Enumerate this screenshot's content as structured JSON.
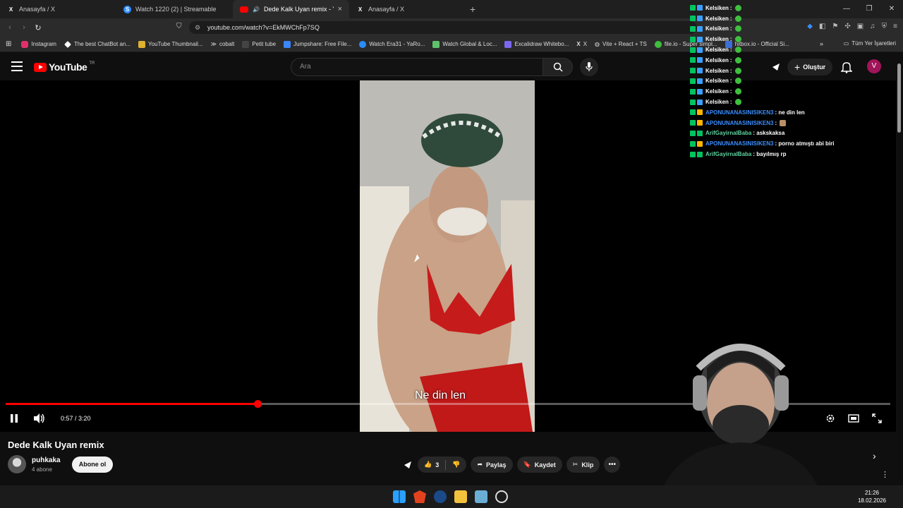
{
  "browser": {
    "tabs": [
      {
        "label": "Anasayfa / X",
        "icon": "x-logo",
        "active": false
      },
      {
        "label": "Watch 1220 (2) | Streamable",
        "icon": "streamable-logo",
        "active": false
      },
      {
        "label": "Dede Kalk Uyan remix - YouTube",
        "icon": "youtube-logo",
        "active": true
      },
      {
        "label": "Anasayfa / X",
        "icon": "x-logo",
        "active": false
      }
    ],
    "url": "youtube.com/watch?v=EkMWChFp7SQ",
    "bookmarks": [
      {
        "label": "Instagram",
        "color": "#e1306c"
      },
      {
        "label": "The best ChatBot an...",
        "color": "#ffffff"
      },
      {
        "label": "YouTube Thumbnail...",
        "color": "#e0b030"
      },
      {
        "label": "cobalt",
        "color": "#ffffff"
      },
      {
        "label": "Petit tube",
        "color": "#333333"
      },
      {
        "label": "Jumpshare: Free File...",
        "color": "#3a86ff"
      },
      {
        "label": "Watch Era31 - YaRo...",
        "color": "#2a8cff"
      },
      {
        "label": "Watch Global & Loc...",
        "color": "#5ec26a"
      },
      {
        "label": "Excalidraw Whitebo...",
        "color": "#7b68ee"
      },
      {
        "label": "X",
        "color": "#ffffff"
      },
      {
        "label": "Vite + React + TS",
        "color": "#cccccc"
      },
      {
        "label": "file.io - Super simpl...",
        "color": "#3fbf3f"
      },
      {
        "label": "hitbox.io - Official Si...",
        "color": "#3c6fd6"
      }
    ],
    "bookmarks_right": "Tüm Yer İşaretleri"
  },
  "youtube": {
    "logo_text": "YouTube",
    "region": "TR",
    "search_placeholder": "Ara",
    "create_label": "Oluştur",
    "avatar_letter": "V"
  },
  "player": {
    "caption": "Ne din len",
    "time": "0:57 / 3:20",
    "progress_fraction": 0.285
  },
  "video": {
    "title": "Dede Kalk Uyan remix",
    "channel": "puhkaka",
    "subscribers": "4 abone",
    "subscribe_label": "Abone ol",
    "likes": "3",
    "share_label": "Paylaş",
    "save_label": "Kaydet",
    "clip_label": "Klip"
  },
  "chat": [
    {
      "user": "Kelsiken",
      "message": ":",
      "emote": "pepe",
      "color": "#ffffff"
    },
    {
      "user": "Kelsiken",
      "message": ":",
      "emote": "pepe",
      "color": "#ffffff"
    },
    {
      "user": "Kelsiken",
      "message": ":",
      "emote": "pepe",
      "color": "#ffffff"
    },
    {
      "user": "Kelsiken",
      "message": ":",
      "emote": "pepe",
      "color": "#ffffff"
    },
    {
      "user": "Kelsiken",
      "message": ":",
      "emote": "pepe",
      "color": "#ffffff"
    },
    {
      "user": "Kelsiken",
      "message": ":",
      "emote": "pepe",
      "color": "#ffffff"
    },
    {
      "user": "Kelsiken",
      "message": ":",
      "emote": "pepe",
      "color": "#ffffff"
    },
    {
      "user": "Kelsiken",
      "message": ":",
      "emote": "pepe",
      "color": "#ffffff"
    },
    {
      "user": "Kelsiken",
      "message": ":",
      "emote": "pepe",
      "color": "#ffffff"
    },
    {
      "user": "Kelsiken",
      "message": ":",
      "emote": "pepe",
      "color": "#ffffff"
    },
    {
      "user": "APONUNANASINISIKEN3",
      "message": ": ne din len",
      "emote": "",
      "color": "#3a8dff"
    },
    {
      "user": "APONUNANASINISIKEN3",
      "message": ":",
      "emote": "cat",
      "color": "#3a8dff"
    },
    {
      "user": "ArifGayirnalBaba",
      "message": ": askskaksa",
      "emote": "",
      "color": "#5fd4a0"
    },
    {
      "user": "APONUNANASINISIKEN3",
      "message": ": porno atmıştı abi biri",
      "emote": "",
      "color": "#3a8dff"
    },
    {
      "user": "ArifGayirnalBaba",
      "message": ": bayılmış rp",
      "emote": "",
      "color": "#5fd4a0"
    }
  ],
  "taskbar": {
    "time": "21:26",
    "date": "18.02.2026"
  }
}
